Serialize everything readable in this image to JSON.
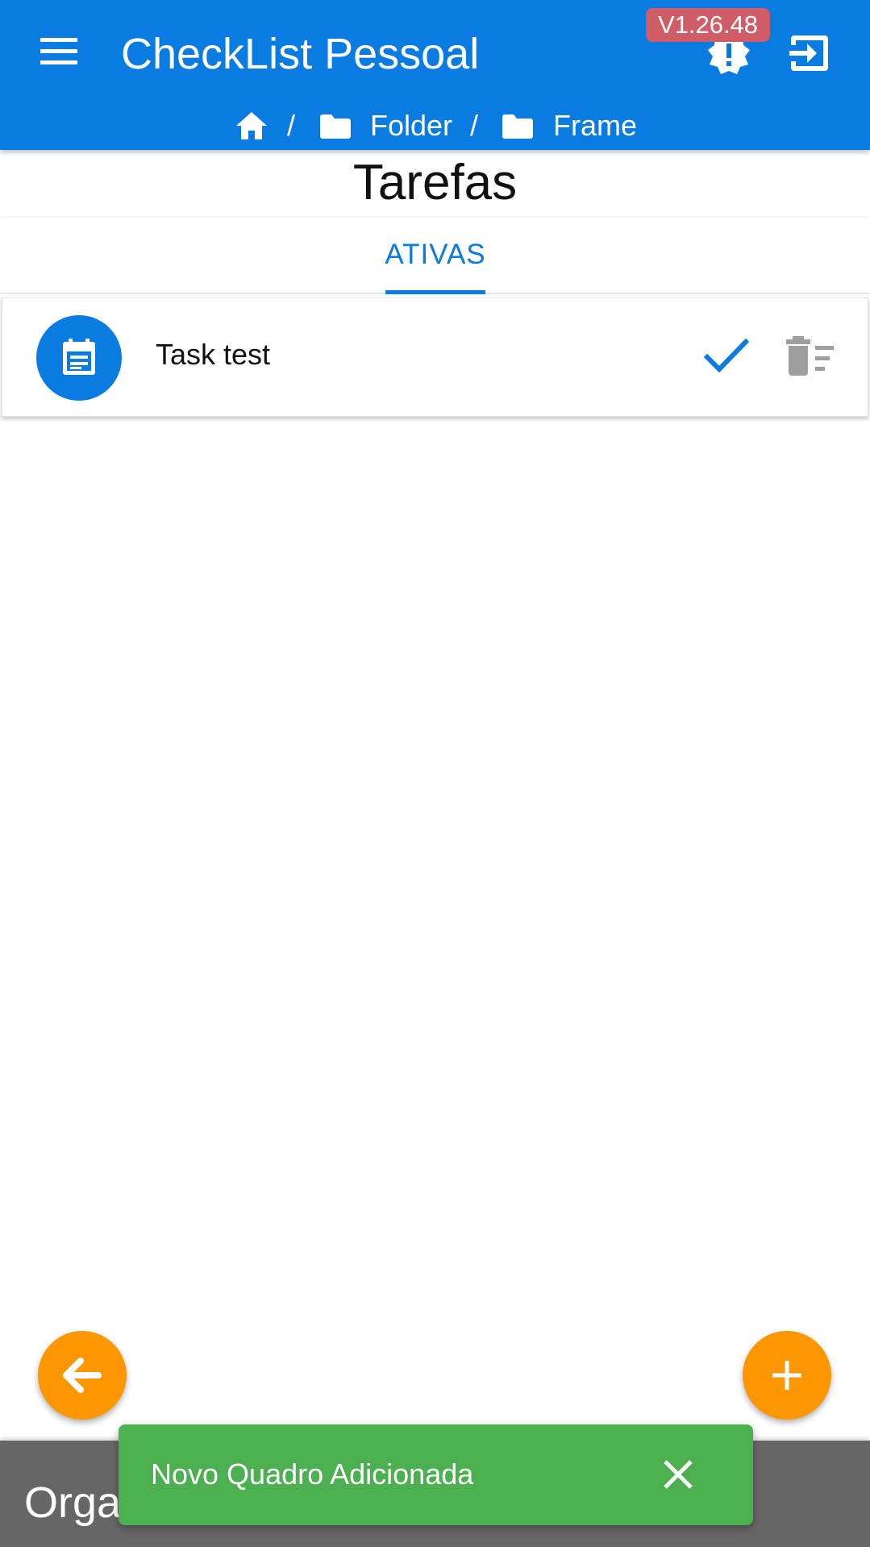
{
  "app_bar": {
    "title": "CheckList Pessoal",
    "version": "V1.26.48",
    "menu_icon": "menu-icon",
    "alert_icon": "alert-badge-icon",
    "logout_icon": "logout-icon"
  },
  "breadcrumb": {
    "home_icon": "home-icon",
    "separator": "/",
    "items": [
      {
        "icon": "folder-icon",
        "label": "Folder"
      },
      {
        "icon": "folder-icon",
        "label": "Frame"
      }
    ]
  },
  "page": {
    "title": "Tarefas"
  },
  "tabs": [
    {
      "label": "ATIVAS",
      "active": true
    }
  ],
  "tasks": [
    {
      "name": "Task test",
      "icon": "event-note-icon",
      "complete_icon": "check-icon",
      "delete_icon": "delete-sweep-icon"
    }
  ],
  "fabs": {
    "back_icon": "arrow-back-icon",
    "add_icon": "add-icon"
  },
  "bottom_bar": {
    "text": "Orga"
  },
  "snackbar": {
    "message": "Novo Quadro Adicionada",
    "close_icon": "close-icon"
  },
  "colors": {
    "primary": "#0a7be0",
    "accent": "#fc9602",
    "version_badge": "#cf5c67",
    "snackbar": "#4caf50",
    "bottom_bar": "#666666",
    "delete_icon": "#9e9e9e"
  }
}
